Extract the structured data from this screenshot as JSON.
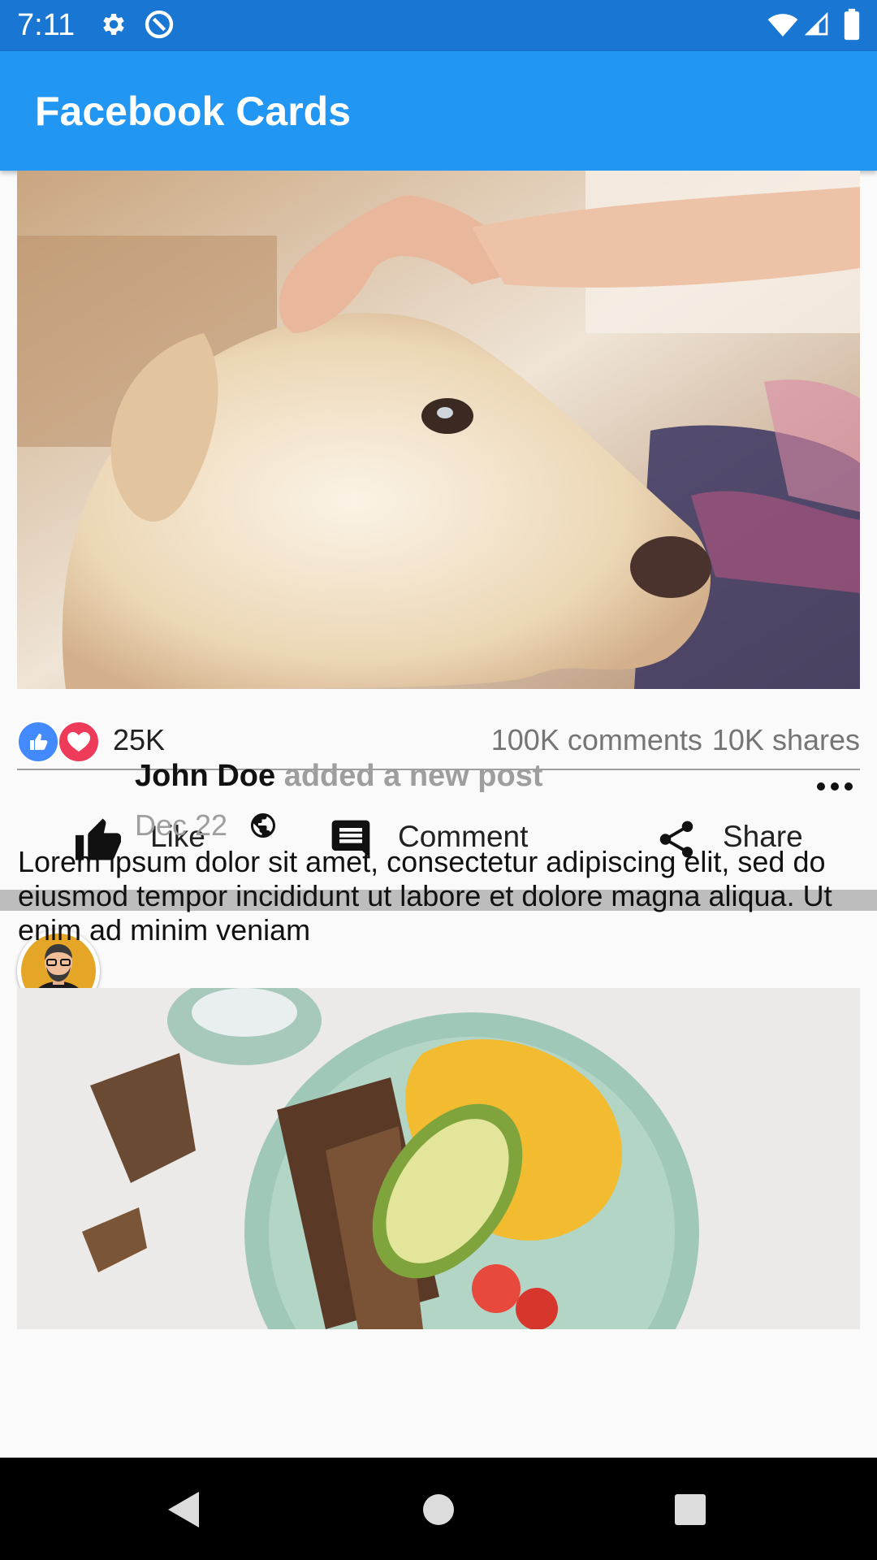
{
  "status_bar": {
    "time": "7:11",
    "left_icons": [
      "settings-gear-icon",
      "data-saver-icon"
    ],
    "right_icons": [
      "wifi-icon",
      "cell-signal-icon",
      "battery-icon"
    ],
    "background": "#1976d2"
  },
  "app_bar": {
    "title": "Facebook Cards",
    "background": "#2196f3"
  },
  "post1": {
    "image": "dog-photo",
    "reactions": {
      "icons": [
        "like-reaction-icon",
        "love-reaction-icon"
      ],
      "count": "25K"
    },
    "comments": "100K comments",
    "shares": "10K shares",
    "actions": [
      {
        "label": "Like",
        "icon": "thumb-up-icon"
      },
      {
        "label": "Comment",
        "icon": "comment-icon"
      },
      {
        "label": "Share",
        "icon": "share-icon"
      }
    ]
  },
  "post2": {
    "author": "John Doe",
    "action": "added a new post",
    "date": "Dec 22",
    "privacy_icon": "globe-icon",
    "menu_icon": "more-horizontal-icon",
    "body": "Lorem ipsum dolor sit amet, consectetur adipiscing elit, sed do eiusmod tempor incididunt ut labore et dolore magna aliqua. Ut enim ad minim veniam",
    "image": "breakfast-food-photo"
  },
  "nav_bar": {
    "buttons": [
      "back-icon",
      "home-icon",
      "recents-icon"
    ]
  }
}
